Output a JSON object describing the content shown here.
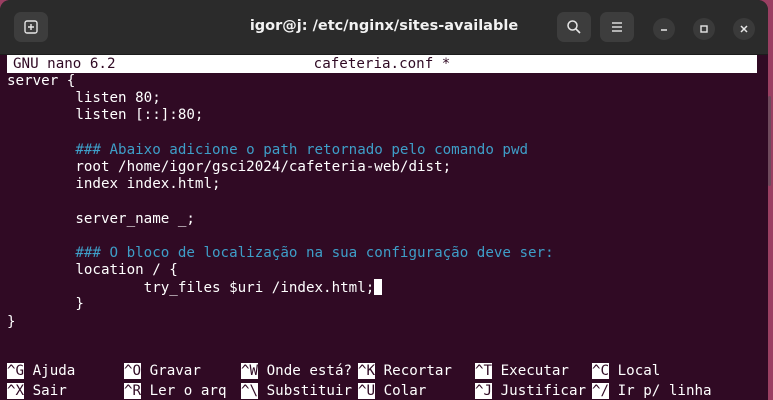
{
  "window": {
    "title": "igor@j: /etc/nginx/sites-available",
    "buttons": [
      "new-tab-icon",
      "search-icon",
      "hamburger-menu-icon",
      "minimize-icon",
      "maximize-icon",
      "close-icon"
    ]
  },
  "nano": {
    "version": "GNU nano 6.2",
    "filename": "cafeteria.conf *"
  },
  "file_lines": [
    {
      "text": "server {",
      "type": "code"
    },
    {
      "text": "        listen 80;",
      "type": "code"
    },
    {
      "text": "        listen [::]:80;",
      "type": "code"
    },
    {
      "text": "",
      "type": "code"
    },
    {
      "text": "        ### Abaixo adicione o path retornado pelo comando pwd",
      "type": "comment"
    },
    {
      "text": "        root /home/igor/gsci2024/cafeteria-web/dist;",
      "type": "code"
    },
    {
      "text": "        index index.html;",
      "type": "code"
    },
    {
      "text": "",
      "type": "code"
    },
    {
      "text": "        server_name _;",
      "type": "code"
    },
    {
      "text": "",
      "type": "code"
    },
    {
      "text": "        ### O bloco de localização na sua configuração deve ser:",
      "type": "comment"
    },
    {
      "text": "        location / {",
      "type": "code"
    },
    {
      "text": "                try_files $uri /index.html;",
      "type": "cursor"
    },
    {
      "text": "        }",
      "type": "code"
    },
    {
      "text": "}",
      "type": "code"
    }
  ],
  "shortcuts": [
    [
      {
        "key": "^G",
        "label": "Ajuda"
      },
      {
        "key": "^O",
        "label": "Gravar"
      },
      {
        "key": "^W",
        "label": "Onde está?"
      },
      {
        "key": "^K",
        "label": "Recortar"
      },
      {
        "key": "^T",
        "label": "Executar"
      },
      {
        "key": "^C",
        "label": "Local"
      }
    ],
    [
      {
        "key": "^X",
        "label": "Sair"
      },
      {
        "key": "^R",
        "label": "Ler o arq"
      },
      {
        "key": "^\\",
        "label": "Substituir"
      },
      {
        "key": "^U",
        "label": "Colar"
      },
      {
        "key": "^J",
        "label": "Justificar"
      },
      {
        "key": "^/",
        "label": "Ir p/ linha"
      }
    ]
  ],
  "colors": {
    "terminal_bg": "#300a24",
    "comment": "#3e9ec8",
    "titlebar": "#2b2b2b"
  }
}
